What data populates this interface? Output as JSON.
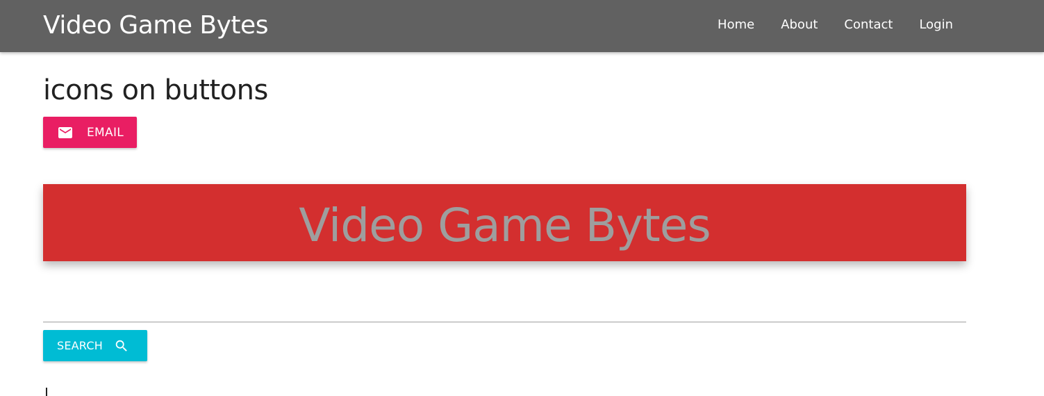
{
  "navbar": {
    "brand": "Video Game Bytes",
    "links": [
      {
        "label": "Home"
      },
      {
        "label": "About"
      },
      {
        "label": "Contact"
      },
      {
        "label": "Login"
      }
    ]
  },
  "main": {
    "heading": "icons on buttons",
    "email_button": {
      "label": "EMAIL",
      "icon": "mail-icon",
      "color": "#e91e63"
    },
    "banner": {
      "text": "Video Game Bytes",
      "background": "#d32f2f",
      "text_color": "#9e9e9e"
    },
    "search_button": {
      "label": "SEARCH",
      "icon": "search-icon",
      "color": "#00bcd4"
    }
  },
  "colors": {
    "navbar": "#616161"
  }
}
